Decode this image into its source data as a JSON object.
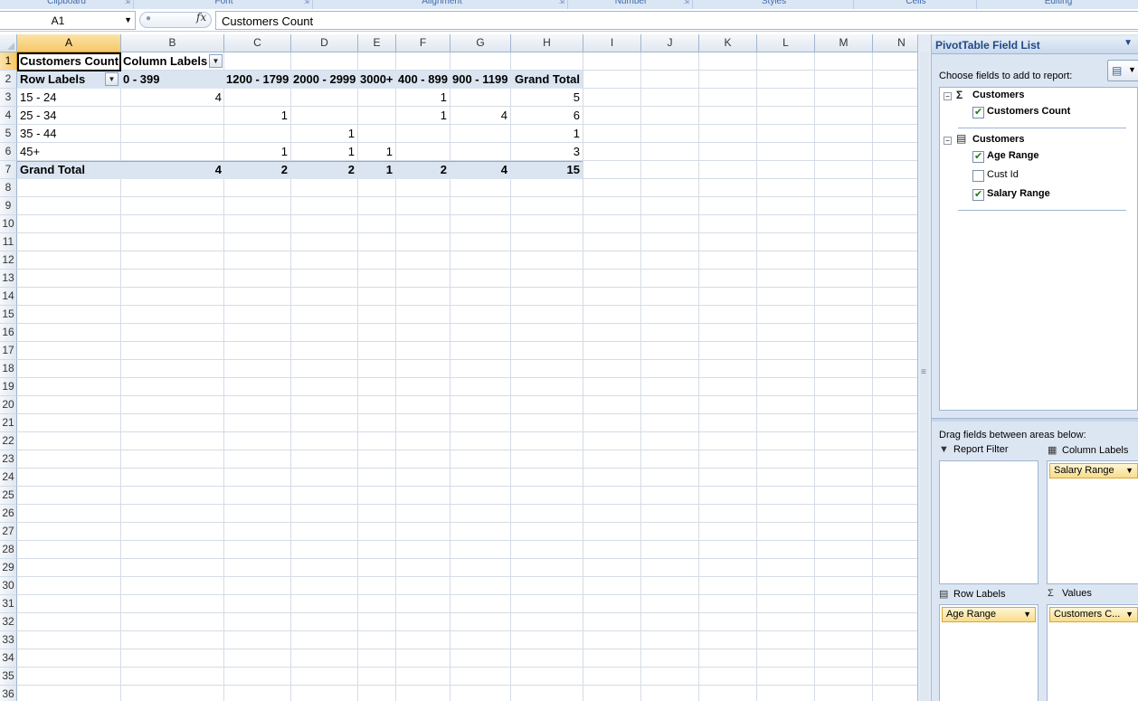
{
  "ribbon": {
    "groups": [
      {
        "label": "Clipboard"
      },
      {
        "label": "Font"
      },
      {
        "label": "Alignment"
      },
      {
        "label": "Number"
      },
      {
        "label": "Styles"
      },
      {
        "label": "Cells"
      },
      {
        "label": "Editing"
      }
    ]
  },
  "formula_bar": {
    "name_box": "A1",
    "fx_icon": "fx",
    "content": "Customers Count"
  },
  "sheet": {
    "columns": [
      "A",
      "B",
      "C",
      "D",
      "E",
      "F",
      "G",
      "H",
      "I",
      "J",
      "K",
      "L",
      "M",
      "N"
    ],
    "selected_column": "A",
    "selected_row": "1",
    "rows": [
      "1",
      "2",
      "3",
      "4",
      "5",
      "6",
      "7",
      "8",
      "9",
      "10",
      "11",
      "12",
      "13",
      "14",
      "15",
      "16",
      "17",
      "18",
      "19",
      "20",
      "21",
      "22",
      "23",
      "24",
      "25",
      "26",
      "27",
      "28",
      "29",
      "30",
      "31",
      "32",
      "33",
      "34",
      "35",
      "36"
    ]
  },
  "pivot": {
    "value_header": "Customers Count",
    "column_labels_header": "Column Labels",
    "row_labels_header": "Row Labels",
    "column_headers": [
      "0 - 399",
      "1200 - 1799",
      "2000 - 2999",
      "3000+",
      "400 - 899",
      "900 - 1199",
      "Grand Total"
    ],
    "rows": [
      {
        "label": "15 - 24",
        "values": [
          "4",
          "",
          "",
          "",
          "1",
          "",
          "5"
        ]
      },
      {
        "label": "25 - 34",
        "values": [
          "",
          "1",
          "",
          "",
          "1",
          "4",
          "6"
        ]
      },
      {
        "label": "35 - 44",
        "values": [
          "",
          "",
          "1",
          "",
          "",
          "",
          "1"
        ]
      },
      {
        "label": "45+",
        "values": [
          "",
          "1",
          "1",
          "1",
          "",
          "",
          "3"
        ]
      }
    ],
    "grand_total": {
      "label": "Grand Total",
      "values": [
        "4",
        "2",
        "2",
        "1",
        "2",
        "4",
        "15"
      ]
    }
  },
  "field_list": {
    "title": "PivotTable Field List",
    "choose_label": "Choose fields to add to report:",
    "groups": [
      {
        "name": "Customers",
        "icon": "sigma-icon",
        "fields": [
          {
            "label": "Customers Count",
            "checked": true
          }
        ]
      },
      {
        "name": "Customers",
        "icon": "table-icon",
        "fields": [
          {
            "label": "Age Range",
            "checked": true
          },
          {
            "label": "Cust Id",
            "checked": false
          },
          {
            "label": "Salary Range",
            "checked": true
          }
        ]
      }
    ],
    "drag_label": "Drag fields between areas below:",
    "areas": {
      "report_filter": {
        "title": "Report Filter",
        "items": []
      },
      "column_labels": {
        "title": "Column Labels",
        "items": [
          "Salary Range"
        ]
      },
      "row_labels": {
        "title": "Row Labels",
        "items": [
          "Age Range"
        ]
      },
      "values": {
        "title": "Values",
        "items": [
          "Customers C..."
        ]
      }
    }
  }
}
